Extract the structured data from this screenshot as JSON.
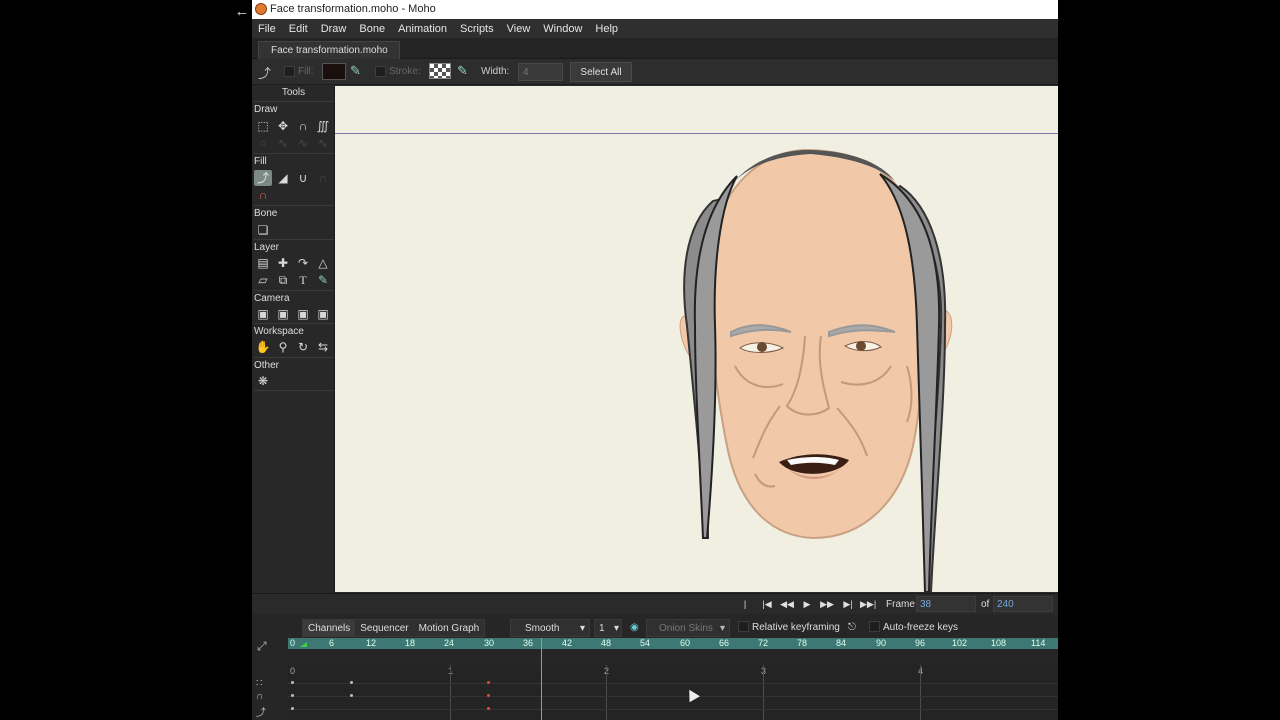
{
  "window": {
    "title": "Face transformation.moho - Moho",
    "back_icon": "arrow-left-icon"
  },
  "menu": [
    "File",
    "Edit",
    "Draw",
    "Bone",
    "Animation",
    "Scripts",
    "View",
    "Window",
    "Help"
  ],
  "document_tab": "Face transformation.moho",
  "options_bar": {
    "fill_label": "Fill:",
    "stroke_label": "Stroke:",
    "width_label": "Width:",
    "width_value": "4",
    "select_all": "Select All",
    "fill_color": "#1a0f0c"
  },
  "tools": {
    "title": "Tools",
    "sections": [
      "Draw",
      "Fill",
      "Bone",
      "Layer",
      "Camera",
      "Workspace",
      "Other"
    ]
  },
  "transport": {
    "frame_label": "Frame",
    "frame_value": "38",
    "of_label": "of",
    "total_frames": "240"
  },
  "timeline": {
    "tabs": [
      "Channels",
      "Sequencer",
      "Motion Graph"
    ],
    "interpolation": "Smooth",
    "interp_count": "1",
    "onion_skins": "Onion Skins",
    "relative_keyframing": "Relative keyframing",
    "auto_freeze": "Auto-freeze keys",
    "ruler_labels": [
      "0",
      "6",
      "12",
      "18",
      "24",
      "30",
      "36",
      "42",
      "48",
      "54",
      "60",
      "66",
      "72",
      "78",
      "84",
      "90",
      "96",
      "102",
      "108",
      "114"
    ],
    "second_labels": [
      "0",
      "1",
      "2",
      "3",
      "4"
    ]
  },
  "colors": {
    "canvas_bg": "#f1efe2",
    "ruler": "#3e7875",
    "skin": "#f2c9a8",
    "hair": "#8c8c8c"
  }
}
